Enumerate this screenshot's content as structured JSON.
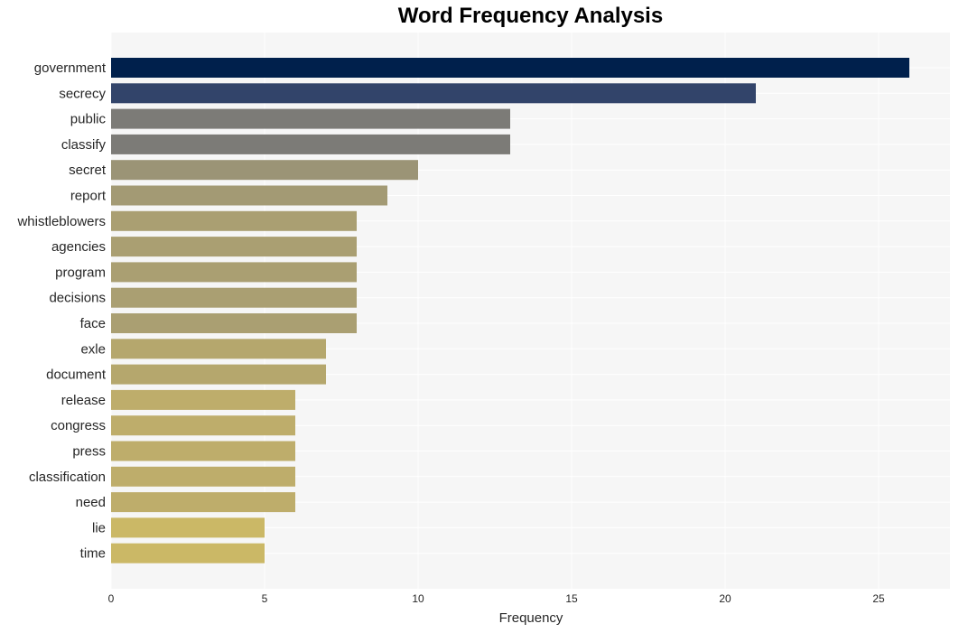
{
  "chart_data": {
    "type": "bar",
    "orientation": "horizontal",
    "title": "Word Frequency Analysis",
    "xlabel": "Frequency",
    "ylabel": "",
    "xlim": [
      0,
      27.3
    ],
    "xticks": [
      0,
      5,
      10,
      15,
      20,
      25
    ],
    "grid": true,
    "categories": [
      "government",
      "secrecy",
      "public",
      "classify",
      "secret",
      "report",
      "whistleblowers",
      "agencies",
      "program",
      "decisions",
      "face",
      "exle",
      "document",
      "release",
      "congress",
      "press",
      "classification",
      "need",
      "lie",
      "time"
    ],
    "values": [
      26,
      21,
      13,
      13,
      10,
      9,
      8,
      8,
      8,
      8,
      8,
      7,
      7,
      6,
      6,
      6,
      6,
      6,
      5,
      5
    ],
    "colors": [
      "#00204c",
      "#32446a",
      "#7c7b77",
      "#7c7b77",
      "#9b9476",
      "#a39a74",
      "#aa9f72",
      "#aa9f72",
      "#aa9f72",
      "#aa9f72",
      "#aa9f72",
      "#b5a76d",
      "#b5a76d",
      "#bead6b",
      "#bead6b",
      "#bead6b",
      "#bead6b",
      "#bead6b",
      "#cbb866",
      "#cbb866"
    ]
  }
}
